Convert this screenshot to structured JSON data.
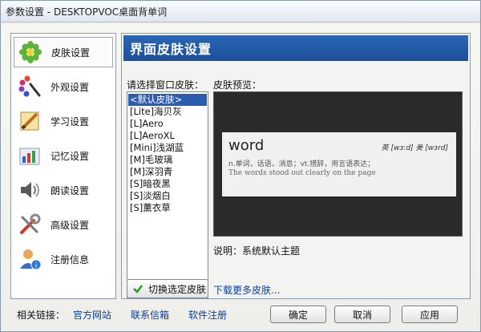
{
  "window": {
    "title": "参数设置 - DESKTOPVOC桌面背单词"
  },
  "sidebar": {
    "items": [
      {
        "label": "皮肤设置",
        "icon": "flower-icon",
        "active": true
      },
      {
        "label": "外观设置",
        "icon": "palette-icon"
      },
      {
        "label": "学习设置",
        "icon": "ruler-pencil-icon"
      },
      {
        "label": "记忆设置",
        "icon": "bar-chart-icon"
      },
      {
        "label": "朗读设置",
        "icon": "speaker-icon"
      },
      {
        "label": "高级设置",
        "icon": "tools-icon"
      },
      {
        "label": "注册信息",
        "icon": "user-info-icon"
      }
    ]
  },
  "main": {
    "header": "界面皮肤设置",
    "select_label": "请选择窗口皮肤：",
    "preview_label": "皮肤预览：",
    "skins": [
      "<默认皮肤>",
      "[Lite]海贝灰",
      "[L]Aero",
      "[L]AeroXL",
      "[Mini]浅湖蓝",
      "[M]毛玻璃",
      "[M]深羽青",
      "[S]暗夜黑",
      "[S]淡烟白",
      "[S]薰衣草"
    ],
    "selected_index": 0,
    "preview": {
      "word": "word",
      "phonetic": "英 [wɜːd] 美 [wɜrd]",
      "definition": "n.单词，话语，消息；vt.措辞，用言语表达；",
      "example": "The words stood out clearly on the page"
    },
    "description": "说明：系统默认主题",
    "switch_button": "切换选定皮肤",
    "download_link": "下载更多皮肤..."
  },
  "footer": {
    "related_label": "相关链接：",
    "links": [
      "官方网站",
      "联系信箱",
      "软件注册"
    ],
    "ok": "确定",
    "cancel": "取消",
    "apply": "应用"
  },
  "colors": {
    "header_blue": "#1d4f99",
    "link_blue": "#0b3e9a",
    "selection_blue": "#2a5db0"
  }
}
